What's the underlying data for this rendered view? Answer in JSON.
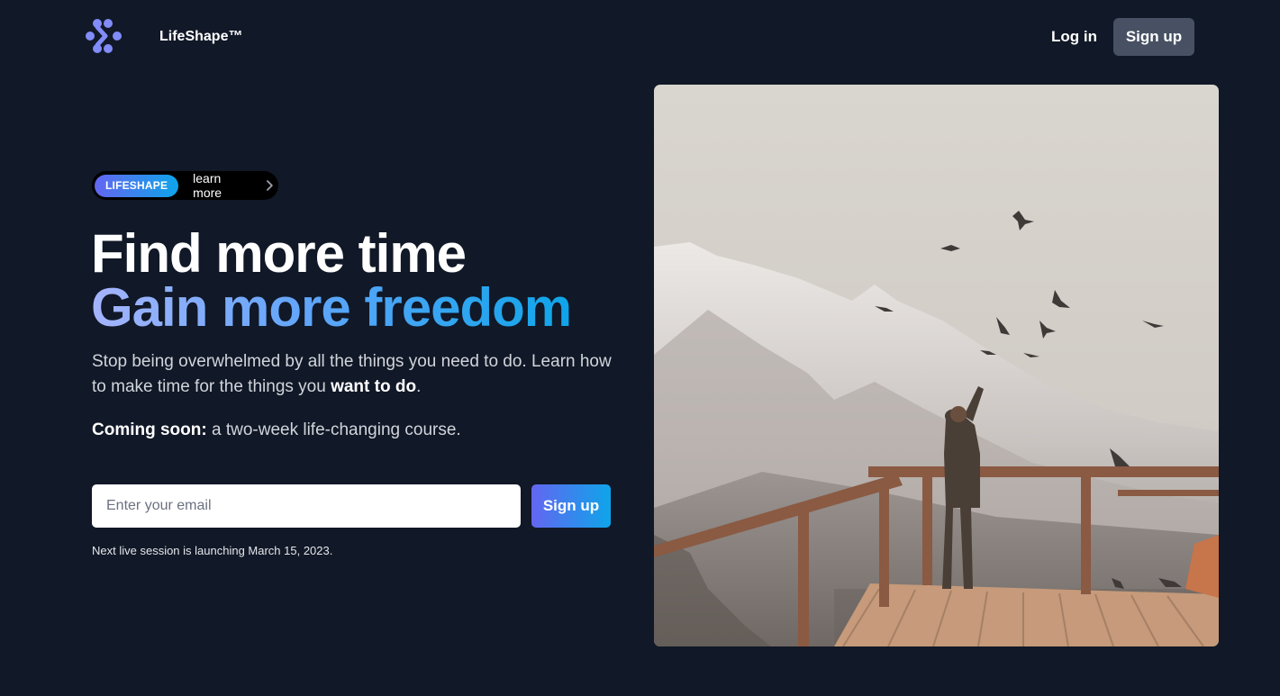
{
  "header": {
    "logo_icon": "dots-chevron-logo-icon",
    "brand": "LifeShape™",
    "login_label": "Log in",
    "signup_label": "Sign up"
  },
  "announcement": {
    "badge": "LIFESHAPE",
    "link_text": "learn more",
    "chevron_icon": "chevron-right-icon"
  },
  "hero": {
    "title_line1": "Find more time",
    "title_line2": "Gain more freedom",
    "description_part1": "Stop being overwhelmed by all the things you need to do. Learn how to make time for the things you ",
    "description_bold": "want to do",
    "description_end": ".",
    "soon_bold": "Coming soon:",
    "soon_text": " a two-week life-changing course."
  },
  "signup_form": {
    "email_placeholder": "Enter your email",
    "email_value": "",
    "button_label": "Sign up",
    "note": "Next live session is launching March 15, 2023."
  },
  "image": {
    "subject": "mountain-lookout-photo"
  },
  "colors": {
    "background": "#111827",
    "accent_start": "#6366f1",
    "accent_end": "#0ea5e9",
    "secondary_button": "#475163"
  }
}
